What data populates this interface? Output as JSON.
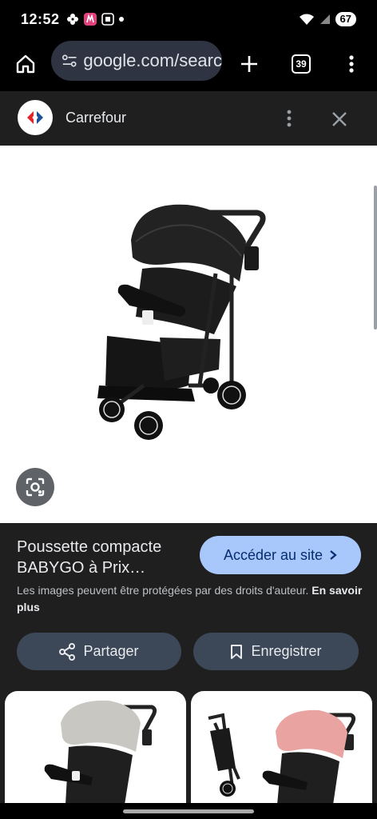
{
  "status": {
    "time": "12:52",
    "battery": "67",
    "icons": [
      "flower-icon",
      "app-icon",
      "screenshot-icon",
      "dot-icon",
      "wifi-icon",
      "signal-icon"
    ]
  },
  "toolbar": {
    "url": "google.com/searc",
    "tab_count": "39"
  },
  "site": {
    "name": "Carrefour"
  },
  "result": {
    "title": "Poussette compacte BABYGO à Prix…",
    "visit_label": "Accéder au site",
    "copyright": "Les images peuvent être protégées par des droits d'auteur.",
    "learn_more": "En savoir plus",
    "share_label": "Partager",
    "save_label": "Enregistrer"
  },
  "colors": {
    "accent_button": "#a8c7fa",
    "action_button": "#3c4758",
    "panel": "#1f1f1f"
  }
}
